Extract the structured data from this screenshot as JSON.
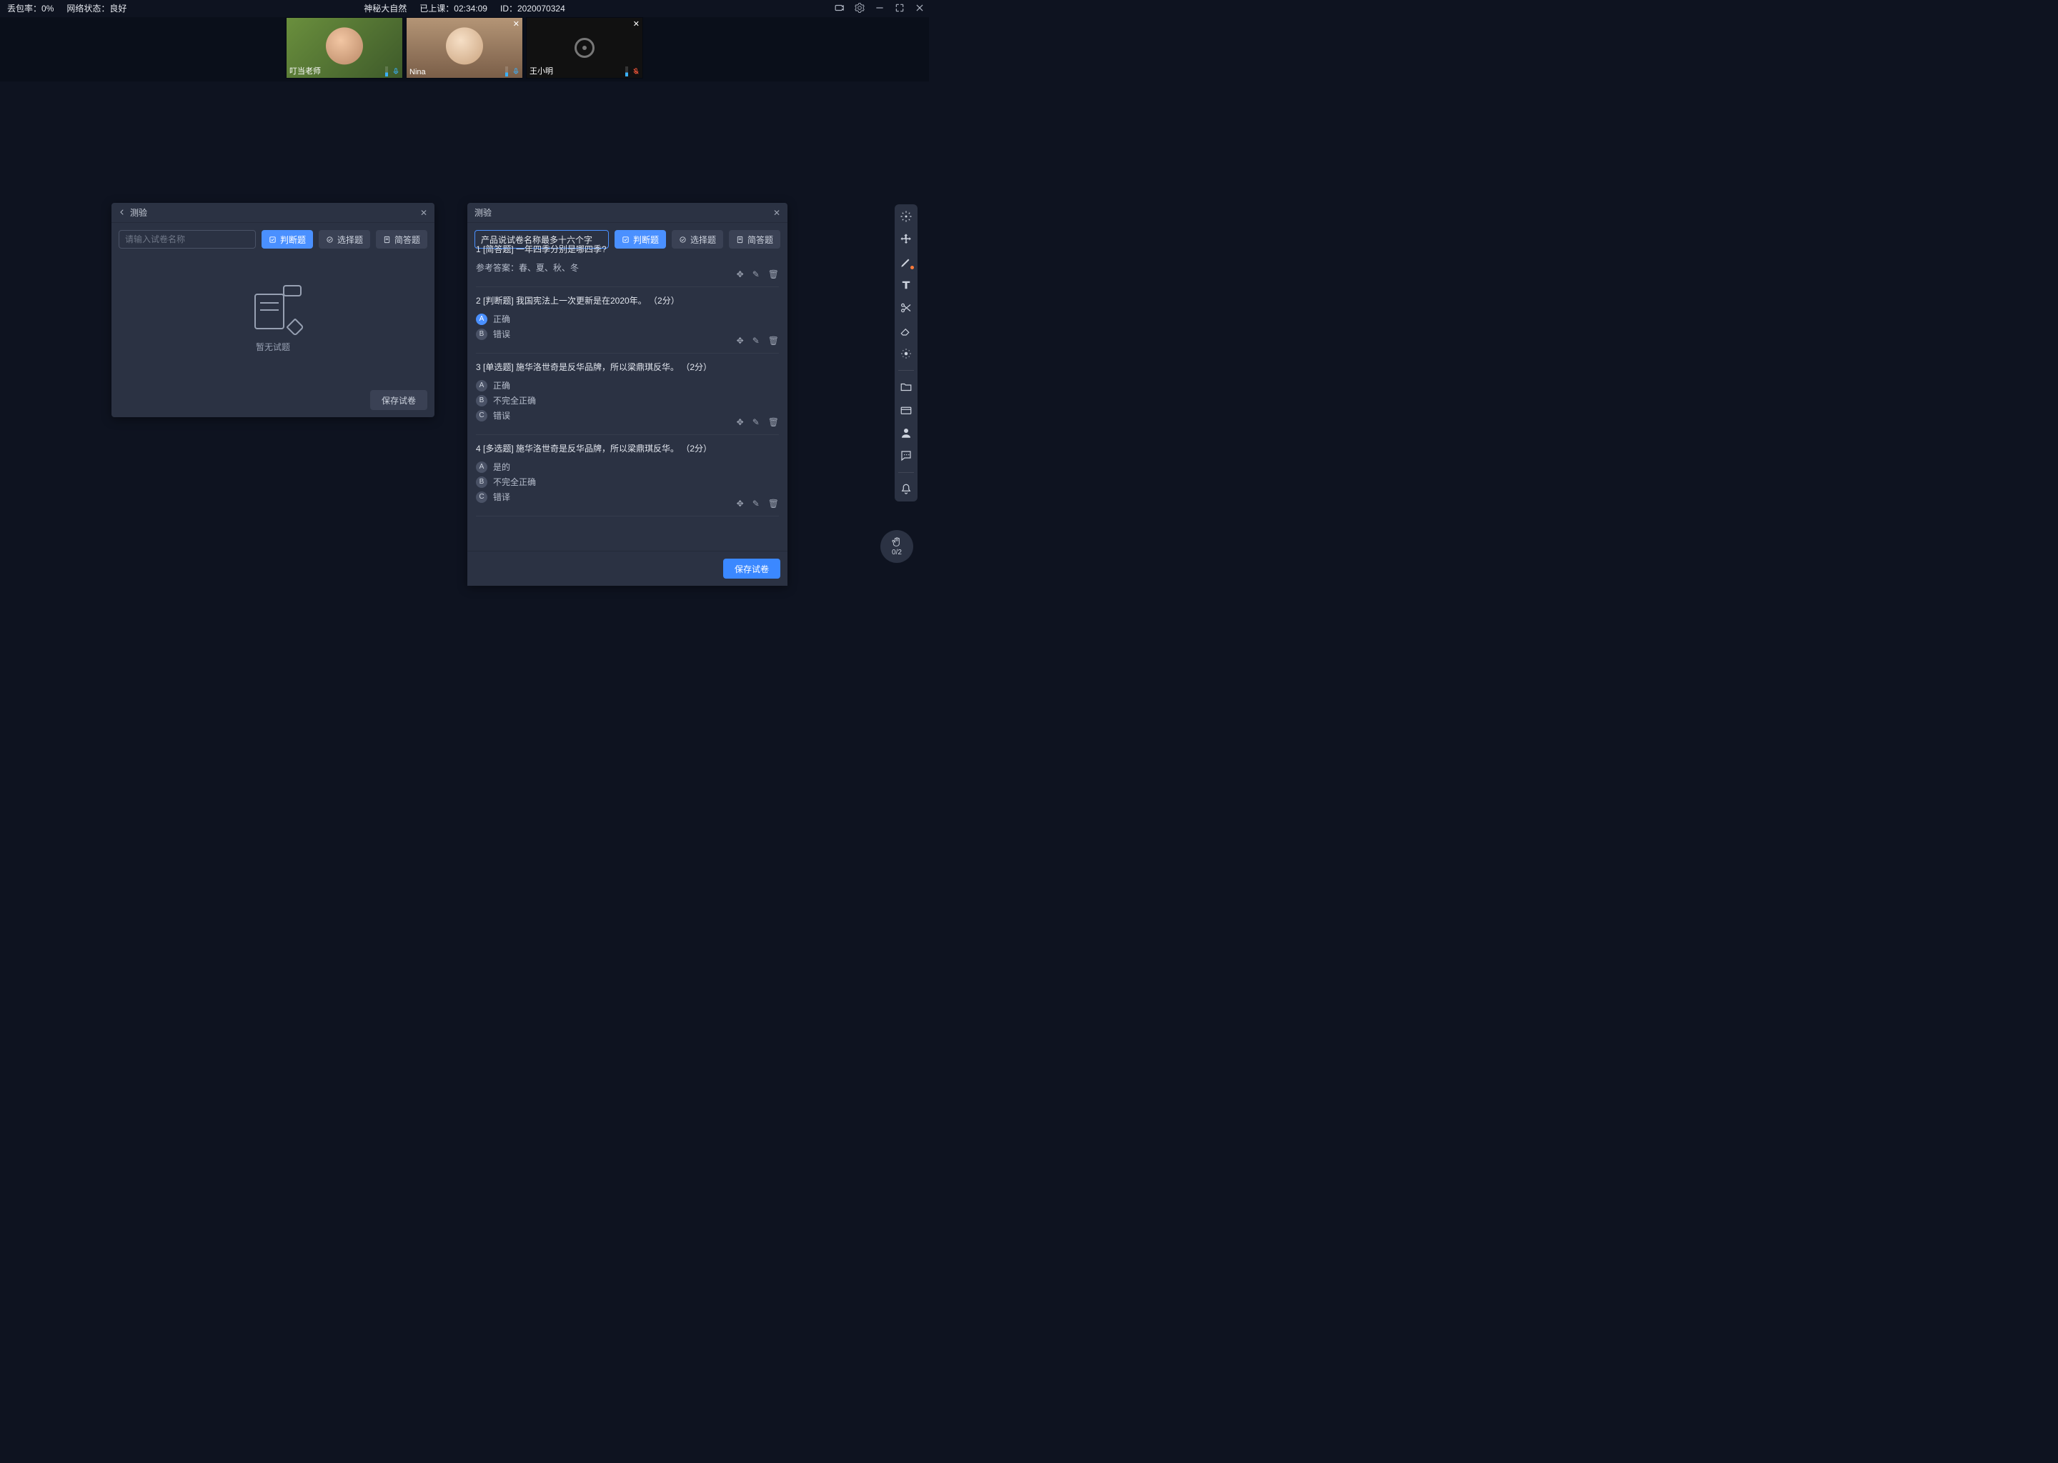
{
  "topbar": {
    "loss_label": "丢包率：",
    "loss_value": "0%",
    "net_label": "网络状态：",
    "net_value": "良好",
    "course_name": "神秘大自然",
    "time_label": "已上课：",
    "time_value": "02:34:09",
    "id_label": "ID：",
    "id_value": "2020070324"
  },
  "videos": [
    {
      "name": "叮当老师",
      "closable": false,
      "camera": "on"
    },
    {
      "name": "Nina",
      "closable": true,
      "camera": "on"
    },
    {
      "name": "王小明",
      "closable": true,
      "camera": "off"
    }
  ],
  "panel_left": {
    "title": "测验",
    "name_placeholder": "请输入试卷名称",
    "btn_judge": "判断题",
    "btn_choice": "选择题",
    "btn_short": "简答题",
    "empty_text": "暂无试题",
    "save": "保存试卷"
  },
  "panel_right": {
    "title": "测验",
    "name_value": "产品说试卷名称最多十六个字",
    "btn_judge": "判断题",
    "btn_choice": "选择题",
    "btn_short": "简答题",
    "save": "保存试卷",
    "questions": [
      {
        "n": "1",
        "tag": "[简答题]",
        "text": "一年四季分别是哪四季?",
        "answer_label": "参考答案：",
        "answer": "春、夏、秋、冬",
        "options": []
      },
      {
        "n": "2",
        "tag": "[判断题]",
        "text": "我国宪法上一次更新是在2020年。",
        "score": "（2分）",
        "options": [
          {
            "k": "A",
            "t": "正确",
            "sel": true
          },
          {
            "k": "B",
            "t": "错误"
          }
        ]
      },
      {
        "n": "3",
        "tag": "[单选题]",
        "text": "施华洛世奇是反华品牌，所以梁鼎琪反华。",
        "score": "（2分）",
        "options": [
          {
            "k": "A",
            "t": "正确"
          },
          {
            "k": "B",
            "t": "不完全正确"
          },
          {
            "k": "C",
            "t": "错误"
          }
        ]
      },
      {
        "n": "4",
        "tag": "[多选题]",
        "text": "施华洛世奇是反华品牌，所以梁鼎琪反华。",
        "score": "（2分）",
        "options": [
          {
            "k": "A",
            "t": "是的"
          },
          {
            "k": "B",
            "t": "不完全正确"
          },
          {
            "k": "C",
            "t": "错译"
          }
        ]
      }
    ]
  },
  "hand": {
    "count": "0/2"
  }
}
